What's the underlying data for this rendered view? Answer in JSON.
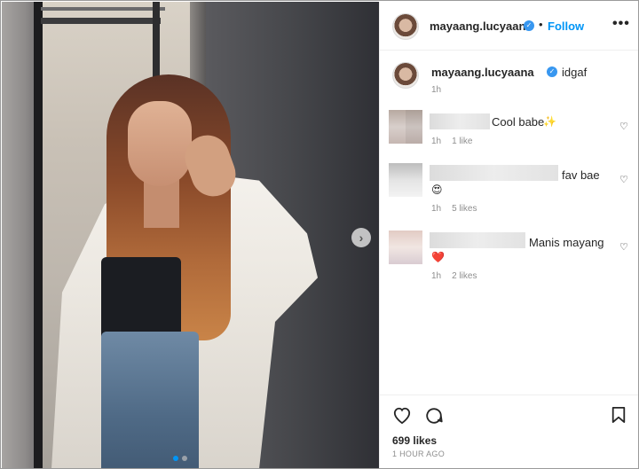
{
  "post": {
    "username": "mayaang.lucyaana",
    "follow_label": "Follow",
    "separator": "•",
    "more_label": "•••",
    "caption": "idgaf",
    "caption_time": "1h",
    "next_icon": "chevron-right-icon"
  },
  "comments": [
    {
      "text": "Cool babe",
      "emoji": "✨",
      "time": "1h",
      "likes": "1 like"
    },
    {
      "text": "fav bae",
      "emoji": "😍",
      "time": "1h",
      "likes": "5 likes"
    },
    {
      "text": "Manis mayang",
      "emoji": "❤️",
      "time": "1h",
      "likes": "2 likes"
    }
  ],
  "footer": {
    "likes": "699 likes",
    "time_ago": "1 HOUR AGO"
  },
  "icons": {
    "like": "♡",
    "comment": "◯",
    "save": "🔖",
    "heart_small": "♡",
    "verified": "✓",
    "next": "›"
  },
  "colors": {
    "accent": "#0095f6",
    "verified": "#3897f0",
    "muted": "#8e8e8e"
  }
}
